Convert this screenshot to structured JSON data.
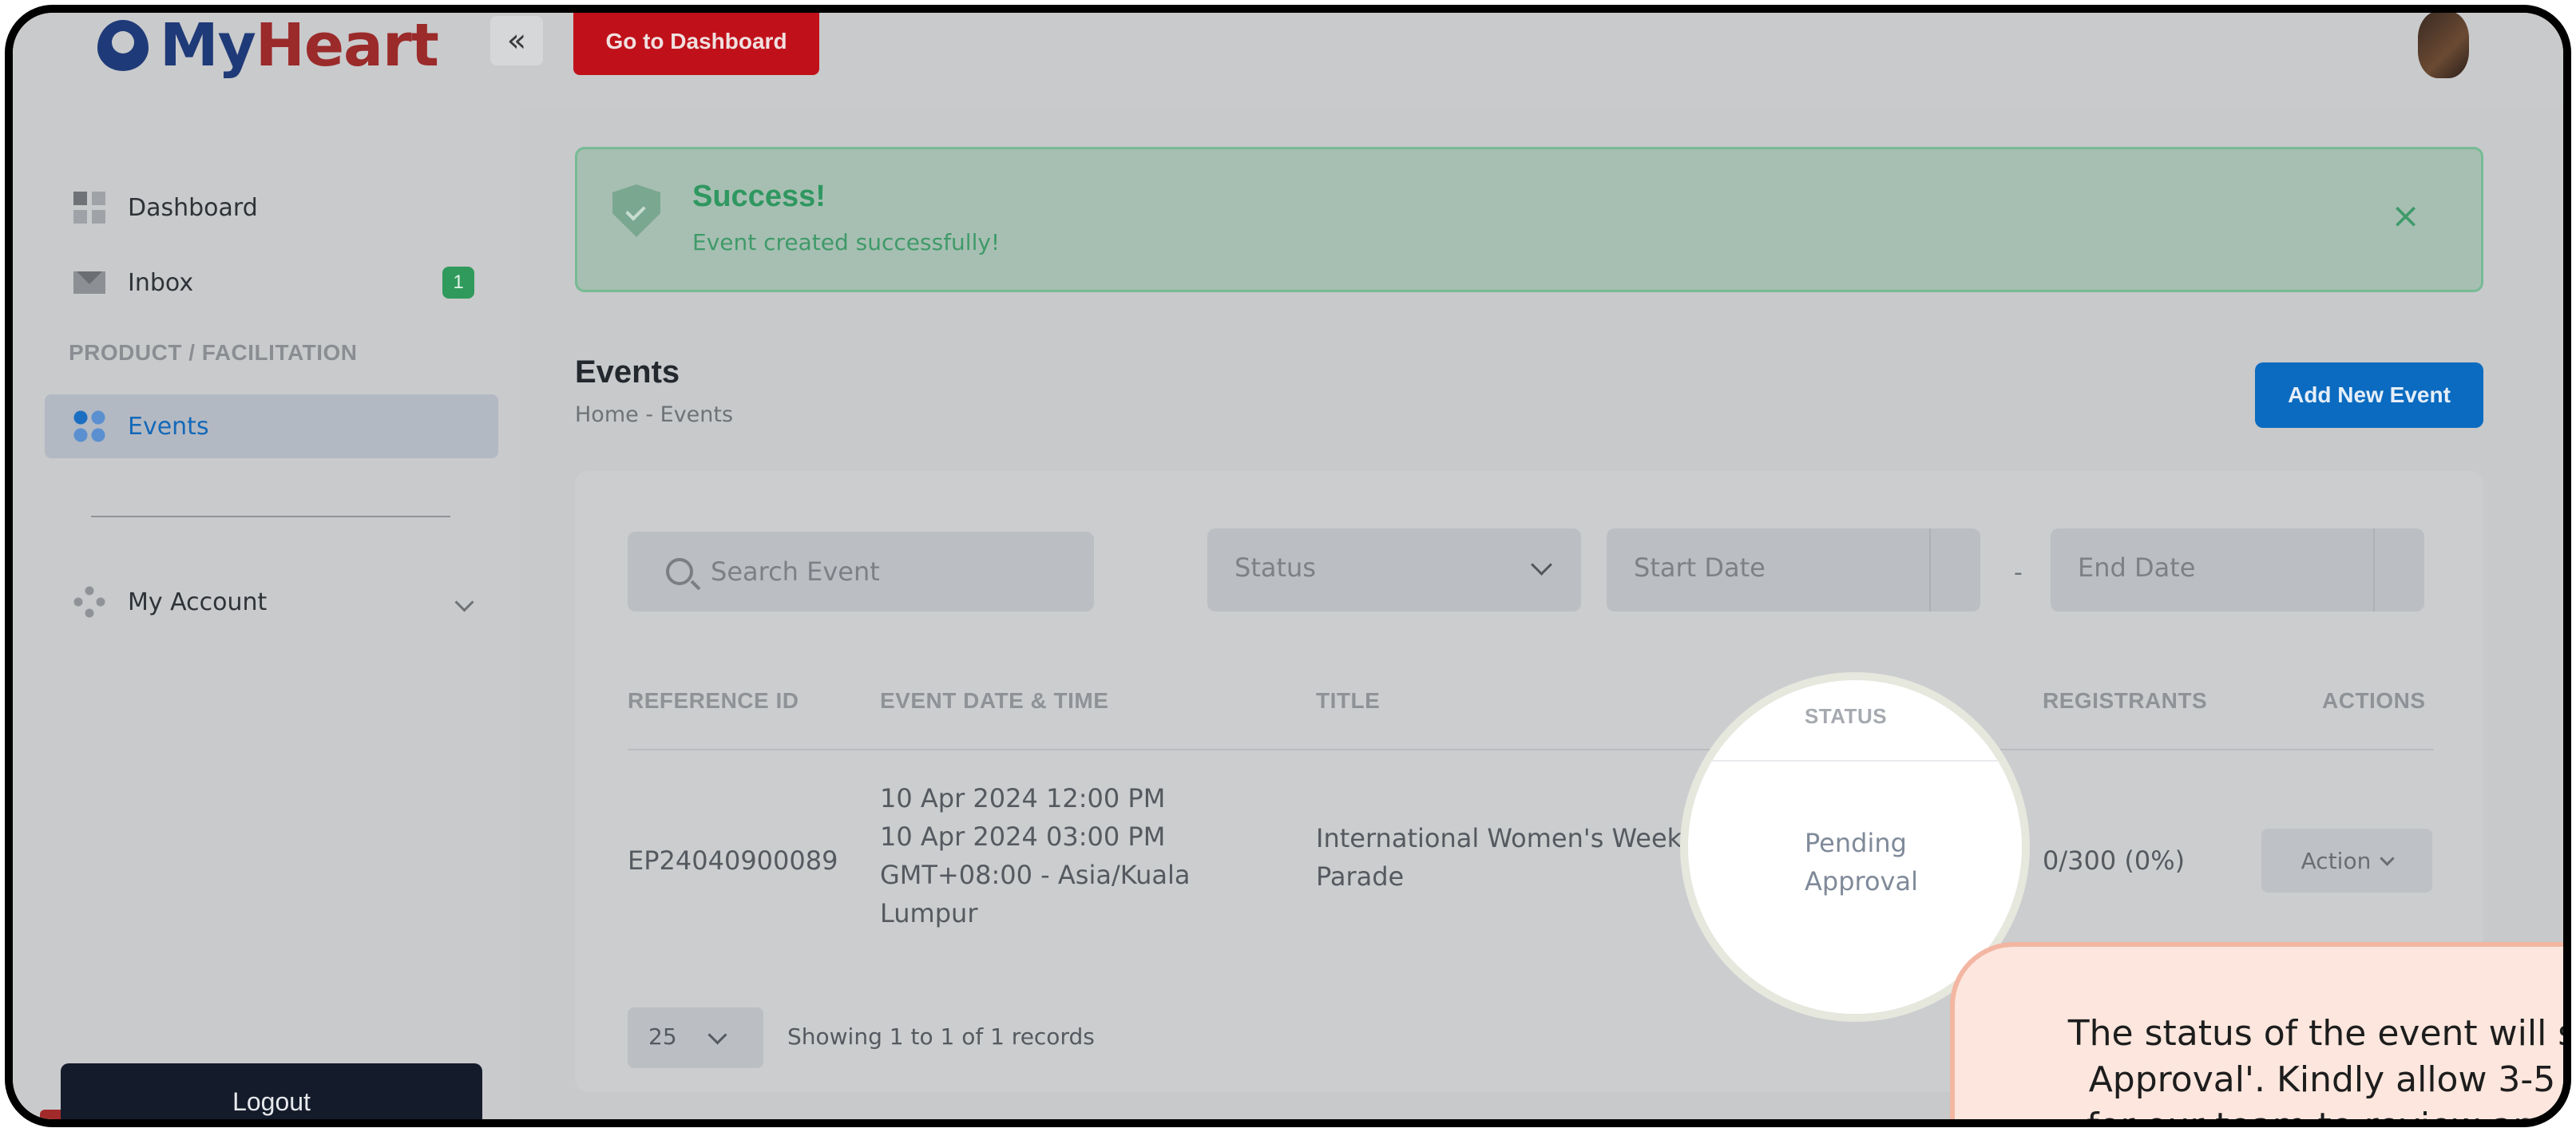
{
  "app": {
    "logo_text_a": "My",
    "logo_text_b": "Heart"
  },
  "topbar": {
    "collapse_glyph": "«",
    "dashboard_button": "Go to Dashboard"
  },
  "sidebar": {
    "items": [
      {
        "label": "Dashboard",
        "icon": "dashboard-icon"
      },
      {
        "label": "Inbox",
        "icon": "inbox-icon",
        "badge": "1"
      }
    ],
    "section_title": "PRODUCT / FACILITATION",
    "section_items": [
      {
        "label": "Events",
        "icon": "events-icon",
        "active": true
      }
    ],
    "account": {
      "label": "My Account",
      "icon": "account-icon"
    },
    "logout": "Logout"
  },
  "alert": {
    "title": "Success!",
    "message": "Event created successfully!",
    "close": "×",
    "color": "#2f9760"
  },
  "page": {
    "title": "Events",
    "breadcrumb": "Home  -  Events",
    "add_button": "Add New Event"
  },
  "filters": {
    "search_placeholder": "Search Event",
    "status_placeholder": "Status",
    "start_date": "Start Date",
    "date_separator": "-",
    "end_date": "End Date"
  },
  "table": {
    "headers": [
      "REFERENCE ID",
      "EVENT DATE & TIME",
      "TITLE",
      "STATUS",
      "REGISTRANTS",
      "ACTIONS"
    ],
    "rows": [
      {
        "reference_id": "EP24040900089",
        "date_line1": "10 Apr 2024 12:00 PM",
        "date_line2": "10 Apr 2024 03:00 PM",
        "date_line3": "GMT+08:00 - Asia/Kuala",
        "date_line4": "Lumpur",
        "title_line1": "International Women's Week",
        "title_line2": "Parade",
        "status_line1": "Pending",
        "status_line2": "Approval",
        "registrants": "0/300 (0%)",
        "action": "Action"
      }
    ]
  },
  "pagination": {
    "page_size": "25",
    "records_text": "Showing 1 to 1 of 1 records"
  },
  "tooltip": {
    "line1": "The status of the event will s",
    "line2": "Approval'. Kindly allow 3-5",
    "line3": "for our team to review and"
  },
  "colors": {
    "brand_red": "#c0111a",
    "primary_blue": "#0b6bc0",
    "success_green": "#2f9a5b",
    "tooltip_bg": "#fce6dd"
  }
}
